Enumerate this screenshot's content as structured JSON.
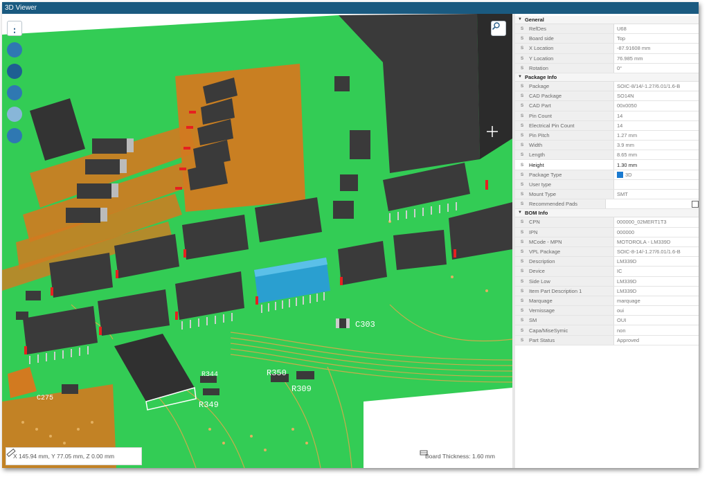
{
  "window": {
    "title": "3D Viewer"
  },
  "status": {
    "coordinates": "X 145.94 mm, Y 77.05 mm, Z 0.00 mm",
    "board_thickness": "Board Thickness: 1.60 mm"
  },
  "board_labels": {
    "c303": "C303",
    "r350": "R350",
    "r309": "R309",
    "r349": "R349",
    "r344": "R344",
    "c275": "C275"
  },
  "properties": {
    "sections": [
      {
        "title": "General",
        "rows": [
          {
            "key": "RefDes",
            "value": "U68"
          },
          {
            "key": "Board side",
            "value": "Top"
          },
          {
            "key": "X Location",
            "value": "-87.91608 mm"
          },
          {
            "key": "Y Location",
            "value": "76.985 mm"
          },
          {
            "key": "Rotation",
            "value": "0°"
          }
        ]
      },
      {
        "title": "Package Info",
        "rows": [
          {
            "key": "Package",
            "value": "SOIC-8/14/-1.27/6.01/1.6-B"
          },
          {
            "key": "CAD Package",
            "value": "SO14N"
          },
          {
            "key": "CAD Part",
            "value": "00x0050"
          },
          {
            "key": "Pin Count",
            "value": "14"
          },
          {
            "key": "Electrical Pin Count",
            "value": "14"
          },
          {
            "key": "Pin Pitch",
            "value": "1.27 mm"
          },
          {
            "key": "Width",
            "value": "3.9 mm"
          },
          {
            "key": "Length",
            "value": "8.65 mm"
          },
          {
            "key": "Height",
            "value": "1.30 mm",
            "highlight": true
          },
          {
            "key": "Package Type",
            "value": "3D",
            "cube": true
          },
          {
            "key": "User type",
            "value": ""
          },
          {
            "key": "Mount Type",
            "value": "SMT"
          },
          {
            "key": "Recommended Pads",
            "value": "",
            "checkbox": true
          }
        ]
      },
      {
        "title": "BOM Info",
        "rows": [
          {
            "key": "CPN",
            "value": "000000_02MERT1T3"
          },
          {
            "key": "IPN",
            "value": "000000"
          },
          {
            "key": "MCode - MPN",
            "value": "MOTOROLA - LM339D"
          },
          {
            "key": "VPL Package",
            "value": "SOIC-8-14/-1.27/6.01/1.6-B"
          },
          {
            "key": "Description",
            "value": "LM339D"
          },
          {
            "key": "Device",
            "value": "IC"
          },
          {
            "key": "Side Low",
            "value": "LM339D"
          },
          {
            "key": "Item Part Description 1",
            "value": "LM339D"
          },
          {
            "key": "Marquage",
            "value": "marquage"
          },
          {
            "key": "Vernissage",
            "value": "oui"
          },
          {
            "key": "SM",
            "value": "OUI"
          },
          {
            "key": "Capa/MiseSymic",
            "value": "non"
          },
          {
            "key": "Part Status",
            "value": "Approved"
          }
        ]
      }
    ]
  },
  "colors": {
    "board": "#33cc55",
    "copper": "#d27a20",
    "component": "#3a3a3a",
    "selected": "#2a9fd0",
    "titlebar": "#1a5a80"
  },
  "icons": [
    "menu-icon",
    "move-icon",
    "measure-icon",
    "magnet-icon",
    "ruler-icon",
    "eraser-icon",
    "zoom-search-icon",
    "ruler-small-icon",
    "board-thickness-icon"
  ]
}
